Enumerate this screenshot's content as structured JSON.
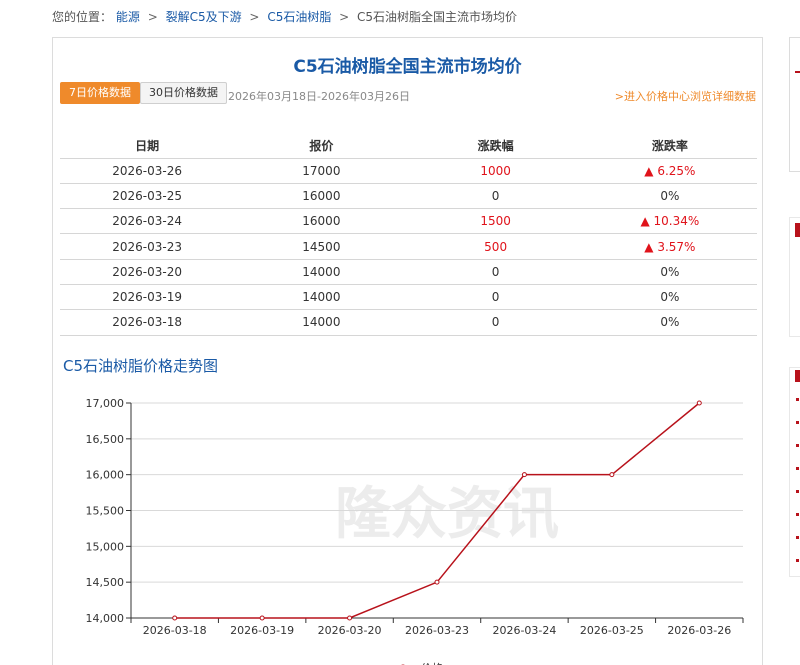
{
  "breadcrumb": {
    "prefix": "您的位置：",
    "items": [
      "能源",
      "裂解C5及下游",
      "C5石油树脂"
    ],
    "current": "C5石油树脂全国主流市场均价",
    "separator": ">"
  },
  "page_title": "C5石油树脂全国主流市场均价",
  "tabs": {
    "seven_day": "7日价格数据",
    "thirty_day": "30日价格数据"
  },
  "date_range": "2026年03月18日-2026年03月26日",
  "detail_link": ">进入价格中心浏览详细数据",
  "table": {
    "headers": [
      "日期",
      "报价",
      "涨跌幅",
      "涨跌率"
    ],
    "rows": [
      {
        "date": "2026-03-26",
        "price": "17000",
        "change": "1000",
        "rate": "▲ 6.25%",
        "up": true
      },
      {
        "date": "2026-03-25",
        "price": "16000",
        "change": "0",
        "rate": "0%",
        "up": false
      },
      {
        "date": "2026-03-24",
        "price": "16000",
        "change": "1500",
        "rate": "▲ 10.34%",
        "up": true
      },
      {
        "date": "2026-03-23",
        "price": "14500",
        "change": "500",
        "rate": "▲ 3.57%",
        "up": true
      },
      {
        "date": "2026-03-20",
        "price": "14000",
        "change": "0",
        "rate": "0%",
        "up": false
      },
      {
        "date": "2026-03-19",
        "price": "14000",
        "change": "0",
        "rate": "0%",
        "up": false
      },
      {
        "date": "2026-03-18",
        "price": "14000",
        "change": "0",
        "rate": "0%",
        "up": false
      }
    ]
  },
  "chart_title": "C5石油树脂价格走势图",
  "watermark": "隆众资讯",
  "colors": {
    "accent": "#1a5aa6",
    "tab_active": "#ef8a2b",
    "up": "#e0131b",
    "line": "#b8121b"
  },
  "chart_data": {
    "type": "line",
    "categories": [
      "2026-03-18",
      "2026-03-19",
      "2026-03-20",
      "2026-03-23",
      "2026-03-24",
      "2026-03-25",
      "2026-03-26"
    ],
    "series": [
      {
        "name": "价格",
        "values": [
          14000,
          14000,
          14000,
          14500,
          16000,
          16000,
          17000
        ]
      }
    ],
    "yticks": [
      "14,000",
      "14,500",
      "15,000",
      "15,500",
      "16,000",
      "16,500",
      "17,000"
    ],
    "ylim": [
      14000,
      17000
    ],
    "grid": true,
    "legend": "bottom"
  }
}
